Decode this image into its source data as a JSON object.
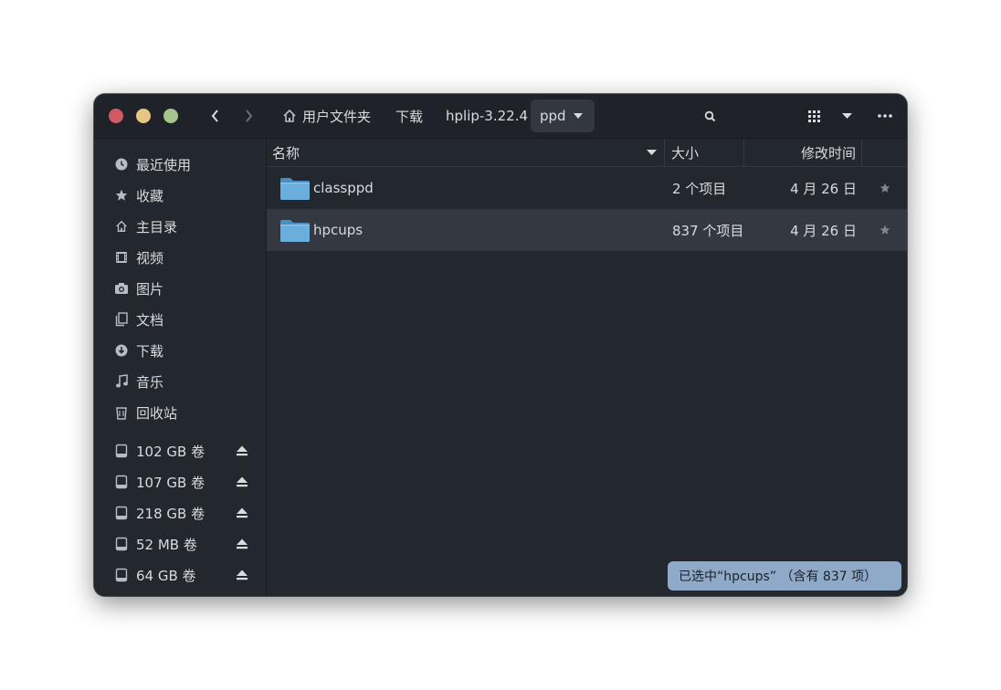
{
  "window": {
    "controls": {
      "close_color": "#d05a64",
      "minimize_color": "#e6c585",
      "maximize_color": "#a4c48c"
    }
  },
  "toolbar": {
    "back_icon": "chevron-left-icon",
    "forward_icon": "chevron-right-icon",
    "breadcrumbs": [
      {
        "label": "用户文件夹",
        "icon": "home-icon"
      },
      {
        "label": "下载"
      },
      {
        "label": "hplip-3.22.4"
      },
      {
        "label": "ppd",
        "active": true
      }
    ],
    "search_icon": "search-icon",
    "view_icon": "grid-view-icon",
    "menu_icon": "more-icon"
  },
  "sidebar": {
    "places": [
      {
        "label": "最近使用",
        "icon": "clock-icon"
      },
      {
        "label": "收藏",
        "icon": "star-icon"
      },
      {
        "label": "主目录",
        "icon": "home-icon"
      },
      {
        "label": "视频",
        "icon": "video-icon"
      },
      {
        "label": "图片",
        "icon": "camera-icon"
      },
      {
        "label": "文档",
        "icon": "document-icon"
      },
      {
        "label": "下载",
        "icon": "download-icon"
      },
      {
        "label": "音乐",
        "icon": "music-icon"
      },
      {
        "label": "回收站",
        "icon": "trash-icon"
      }
    ],
    "volumes": [
      {
        "label": "102 GB 卷",
        "icon": "drive-icon"
      },
      {
        "label": "107 GB 卷",
        "icon": "drive-icon"
      },
      {
        "label": "218 GB 卷",
        "icon": "drive-icon"
      },
      {
        "label": "52 MB 卷",
        "icon": "drive-icon"
      },
      {
        "label": "64 GB 卷",
        "icon": "drive-icon"
      }
    ]
  },
  "list": {
    "columns": {
      "name": "名称",
      "size": "大小",
      "modified": "修改时间"
    },
    "rows": [
      {
        "name": "classppd",
        "size": "2 个项目",
        "modified": "4 月 26 日",
        "selected": false
      },
      {
        "name": "hpcups",
        "size": "837 个项目",
        "modified": "4 月 26 日",
        "selected": true
      }
    ],
    "folder_color": "#6aaede"
  },
  "status": {
    "text": "已选中“hpcups” （含有 837 项）"
  },
  "colors": {
    "background": "#23272e",
    "accent": "#8fa9c9",
    "text": "#d8dbe0"
  }
}
